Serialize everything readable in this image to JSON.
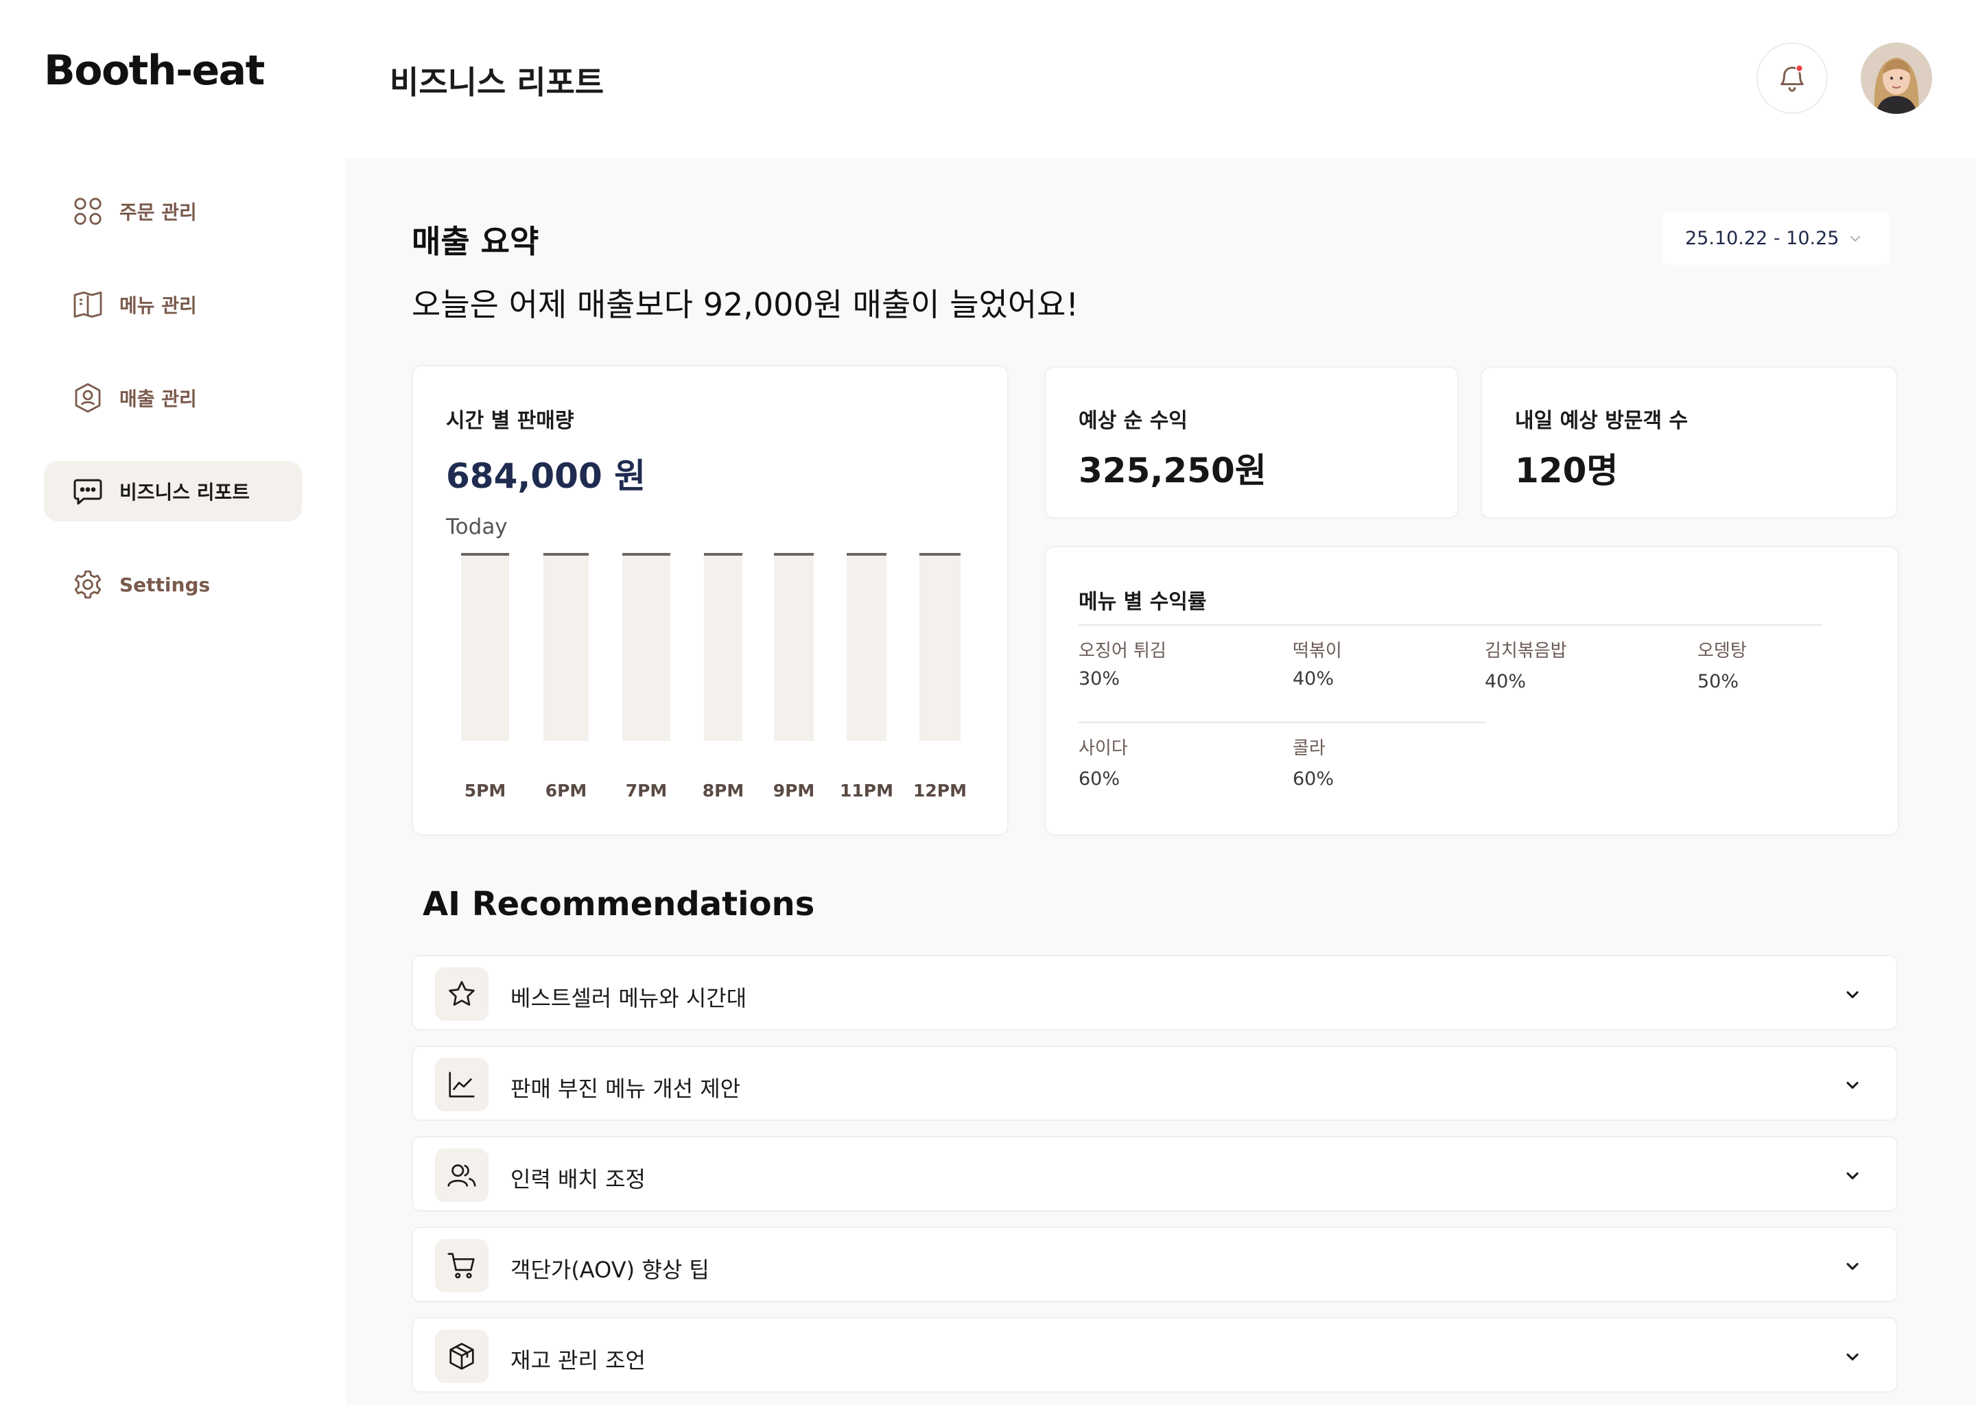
{
  "app": {
    "logo": "Booth-eat",
    "page_title": "비즈니스 리포트"
  },
  "header": {
    "notification_dot_color": "#ef4444",
    "bell_icon": "bell-icon",
    "avatar_icon": "user-avatar"
  },
  "sidebar": {
    "items": [
      {
        "label": "주문 관리",
        "icon": "grid-icon",
        "active": false
      },
      {
        "label": "메뉴 관리",
        "icon": "book-icon",
        "active": false
      },
      {
        "label": "매출 관리",
        "icon": "user-badge-icon",
        "active": false
      },
      {
        "label": "비즈니스 리포트",
        "icon": "chat-icon",
        "active": true
      },
      {
        "label": "Settings",
        "icon": "gear-icon",
        "active": false
      }
    ]
  },
  "summary": {
    "title": "매출 요약",
    "headline": "오늘은 어제 매출보다 92,000원 매출이 늘었어요!",
    "date_range": "25.10.22 - 10.25"
  },
  "sales_card": {
    "label": "시간 별 판매량",
    "amount": "684,000 원",
    "period": "Today"
  },
  "chart_data": {
    "type": "bar",
    "categories": [
      "5PM",
      "6PM",
      "7PM",
      "8PM",
      "9PM",
      "11PM",
      "12PM"
    ],
    "series": [
      {
        "values": [
          1,
          1,
          1,
          1,
          1,
          1,
          1
        ]
      }
    ],
    "title": "시간 별 판매량",
    "xlabel": "",
    "ylabel": "",
    "grid": false
  },
  "profit_card": {
    "label": "예상 순 수익",
    "value": "325,250원"
  },
  "visitor_card": {
    "label": "내일 예상 방문객 수",
    "value": "120명"
  },
  "menu_profit": {
    "label": "메뉴 별 수익률",
    "items": [
      {
        "name": "오징어 튀김",
        "pct": "30%"
      },
      {
        "name": "떡볶이",
        "pct": "40%"
      },
      {
        "name": "김치볶음밥",
        "pct": "40%"
      },
      {
        "name": "오뎅탕",
        "pct": "50%"
      },
      {
        "name": "사이다",
        "pct": "60%"
      },
      {
        "name": "콜라",
        "pct": "60%"
      }
    ]
  },
  "ai": {
    "title": "AI Recommendations",
    "items": [
      {
        "label": "베스트셀러 메뉴와 시간대",
        "icon": "star-icon"
      },
      {
        "label": "판매 부진 메뉴 개선 제안",
        "icon": "trend-chart-icon"
      },
      {
        "label": "인력 배치 조정",
        "icon": "users-icon"
      },
      {
        "label": "객단가(AOV) 향상 팁",
        "icon": "cart-icon"
      },
      {
        "label": "재고 관리 조언",
        "icon": "box-icon"
      }
    ]
  },
  "colors": {
    "accent_navy": "#1f2b50",
    "brown": "#7a5a4c",
    "active_bg": "#f4f0ec",
    "bar_fill": "#f4f0ec"
  }
}
